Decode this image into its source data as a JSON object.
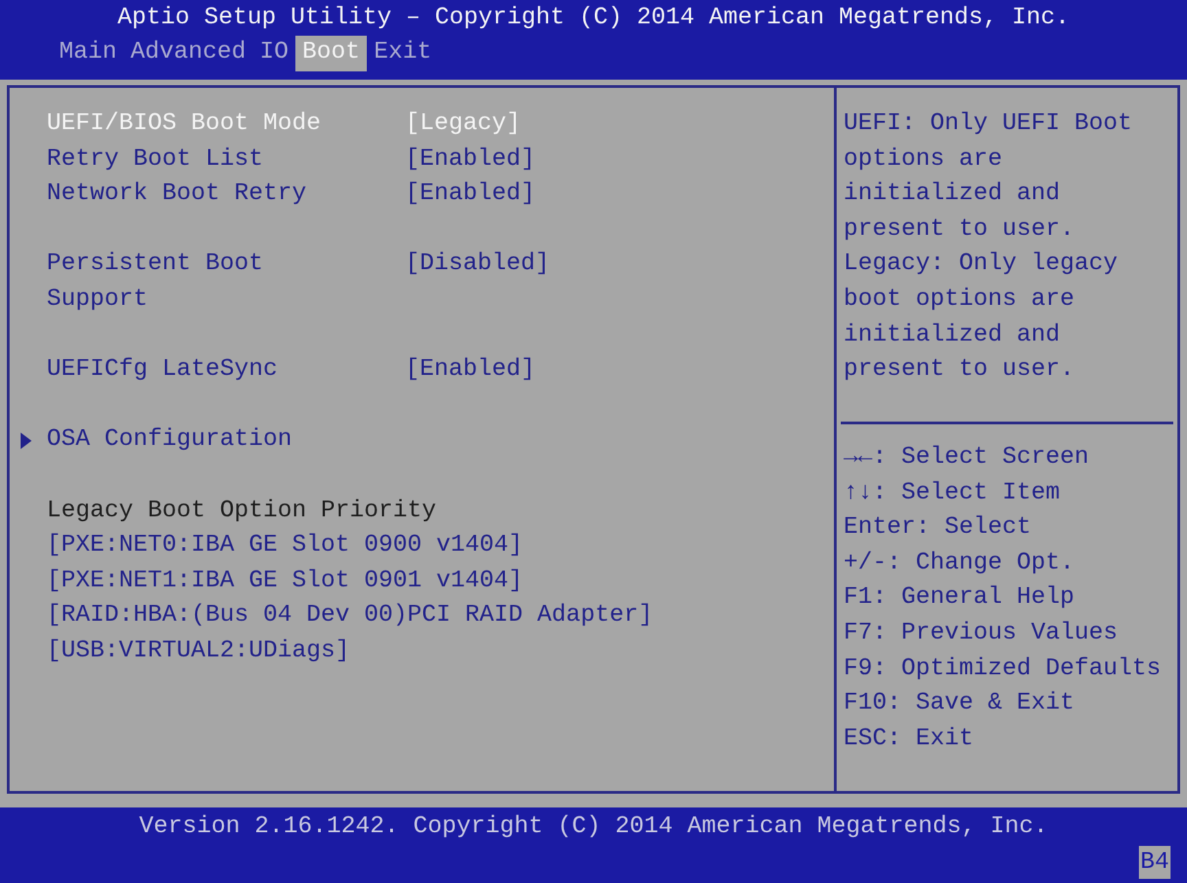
{
  "window": {
    "title": "Aptio Setup Utility – Copyright (C) 2014 American Megatrends, Inc."
  },
  "tabs": [
    {
      "label": "Main",
      "selected": false
    },
    {
      "label": "Advanced",
      "selected": false
    },
    {
      "label": "IO",
      "selected": false
    },
    {
      "label": "Boot",
      "selected": true
    },
    {
      "label": "Exit",
      "selected": false
    }
  ],
  "settings_groups": [
    [
      {
        "kind": "setting",
        "label": "UEFI/BIOS Boot Mode",
        "value": "[Legacy]",
        "selected": true
      },
      {
        "kind": "setting",
        "label": "Retry Boot List",
        "value": "[Enabled]",
        "selected": false
      },
      {
        "kind": "setting",
        "label": "Network Boot Retry",
        "value": "[Enabled]",
        "selected": false
      }
    ],
    [
      {
        "kind": "setting",
        "label": "Persistent Boot Support",
        "value": "[Disabled]",
        "selected": false
      }
    ],
    [
      {
        "kind": "setting",
        "label": "UEFICfg LateSync",
        "value": "[Enabled]",
        "selected": false
      }
    ],
    [
      {
        "kind": "submenu",
        "label": "OSA Configuration",
        "selected": false
      }
    ],
    [
      {
        "kind": "heading",
        "label": "Legacy Boot Option Priority"
      },
      {
        "kind": "boot_option",
        "label": "[PXE:NET0:IBA GE Slot 0900 v1404]",
        "selected": false
      },
      {
        "kind": "boot_option",
        "label": "[PXE:NET1:IBA GE Slot 0901 v1404]",
        "selected": false
      },
      {
        "kind": "boot_option",
        "label": "[RAID:HBA:(Bus 04 Dev 00)PCI RAID Adapter]",
        "selected": false
      },
      {
        "kind": "boot_option",
        "label": "[USB:VIRTUAL2:UDiags]",
        "selected": false
      }
    ]
  ],
  "help_text": [
    "UEFI: Only UEFI Boot options are initialized and present to user.",
    "Legacy: Only legacy boot options are initialized and present to user."
  ],
  "key_help": [
    "→←: Select Screen",
    "↑↓: Select Item",
    "Enter: Select",
    "+/-: Change Opt.",
    "F1: General Help",
    "F7: Previous Values",
    "F9: Optimized Defaults",
    "F10: Save & Exit",
    "ESC: Exit"
  ],
  "status_bar": {
    "text": "Version 2.16.1242. Copyright (C) 2014 American Megatrends, Inc.",
    "badge": "B4"
  }
}
